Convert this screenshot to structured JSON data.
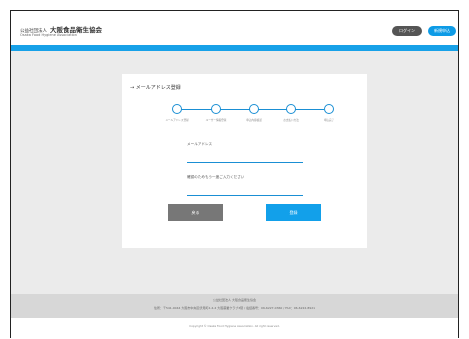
{
  "header": {
    "org_type": "公益社団法人",
    "org_name": "大阪食品衛生協会",
    "org_name_en": "Osaka Food Hygiene Association",
    "login_label": "ログイン",
    "register_label": "新規申込"
  },
  "card": {
    "title": "→ メールアドレス登録",
    "steps": [
      {
        "label": "メールアドレス登録"
      },
      {
        "label": "ユーザー情報登録"
      },
      {
        "label": "申込内容確認"
      },
      {
        "label": "お支払い方法"
      },
      {
        "label": "申込完了"
      }
    ],
    "email_label": "メールアドレス",
    "confirm_label": "確認のためもう一度ご入力ください",
    "back_label": "戻る",
    "next_label": "登録"
  },
  "footer": {
    "line1": "公益社団法人 大阪食品衛生協会",
    "line2": "住所：〒541-0044 大阪市中央区伏見町2-4-4 大阪薬業クラブ3階 / 電話番号：06-6227-0360 / FAX：06-6222-8921",
    "copyright": "Copyright © Osaka Food Hygiene Association. All right reserved."
  }
}
